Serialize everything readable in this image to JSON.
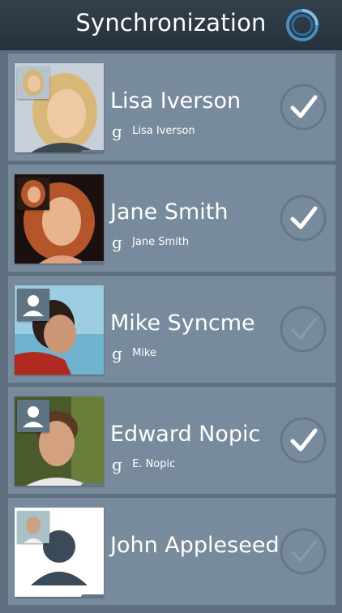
{
  "header": {
    "title": "Synchronization",
    "sync_icon": "sync-icon"
  },
  "contacts": [
    {
      "name": "Lisa Iverson",
      "source_label": "Lisa Iverson",
      "source_icon": "google-icon",
      "checked": true
    },
    {
      "name": "Jane Smith",
      "source_label": "Jane Smith",
      "source_icon": "google-icon",
      "checked": true
    },
    {
      "name": "Mike Syncme",
      "source_label": "Mike",
      "source_icon": "google-icon",
      "checked": false
    },
    {
      "name": "Edward Nopic",
      "source_label": "E. Nopic",
      "source_icon": "google-icon",
      "checked": true
    },
    {
      "name": "John Appleseed",
      "source_label": "",
      "source_icon": "",
      "checked": false
    }
  ],
  "colors": {
    "header": "#2b3640",
    "row": "#788b9c",
    "background": "#5d6e7e",
    "check_active": "#ffffff",
    "check_inactive": "#8a9cac"
  }
}
